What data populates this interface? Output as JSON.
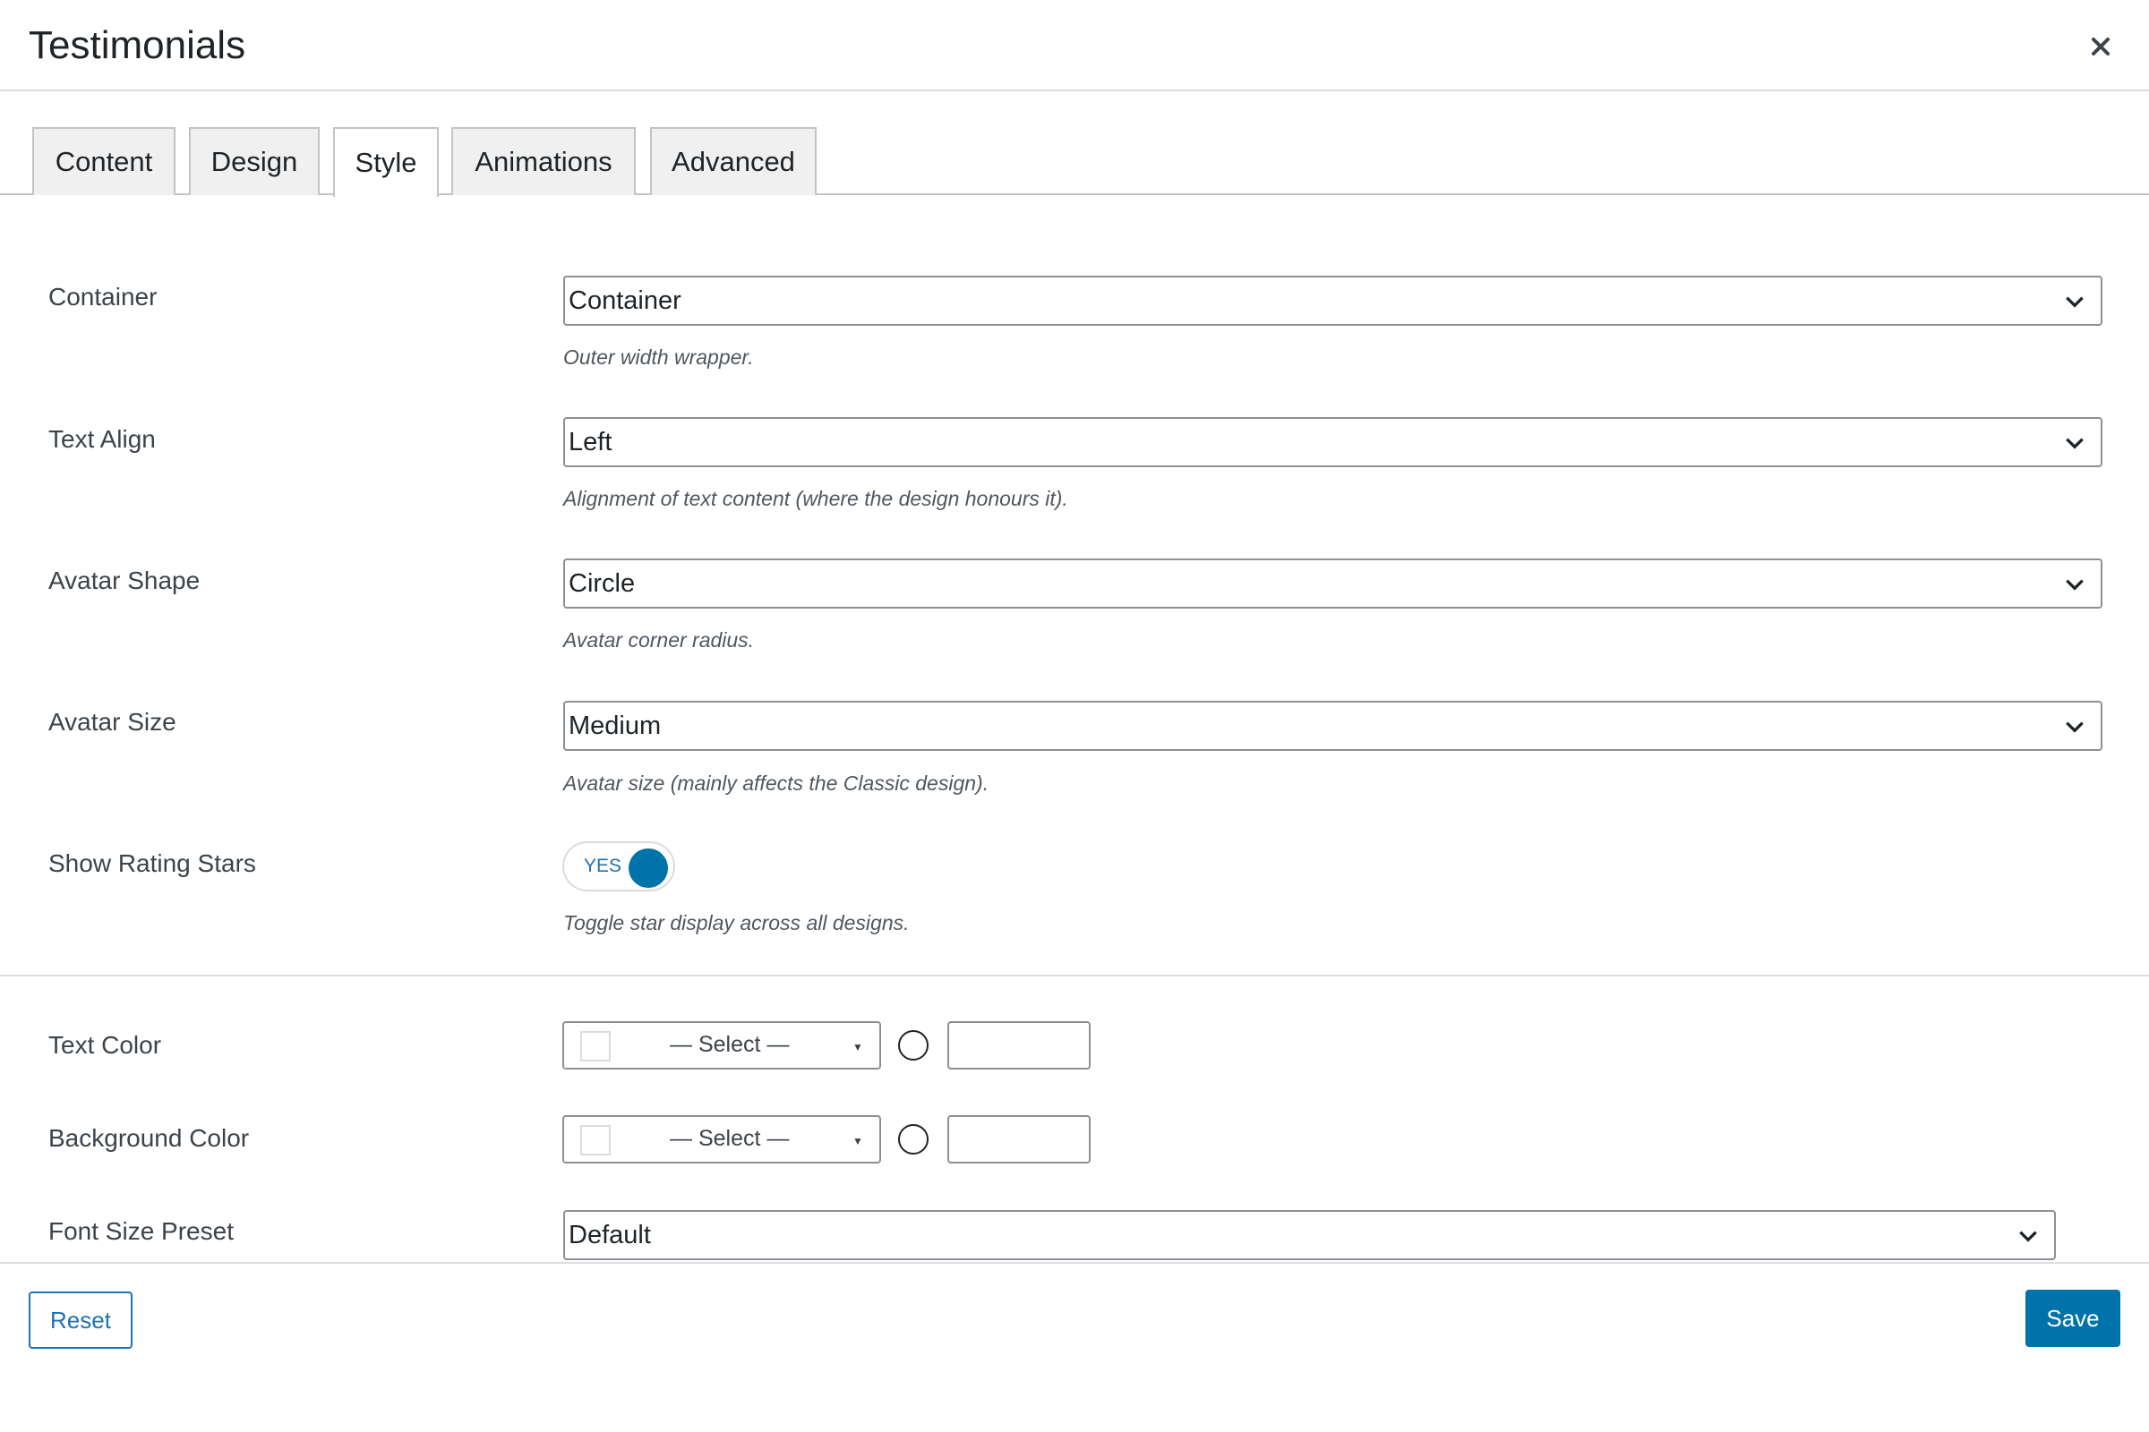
{
  "modal": {
    "title": "Testimonials",
    "close_icon": "close-icon"
  },
  "tabs": [
    {
      "label": "Content",
      "active": false
    },
    {
      "label": "Design",
      "active": false
    },
    {
      "label": "Style",
      "active": true
    },
    {
      "label": "Animations",
      "active": false
    },
    {
      "label": "Advanced",
      "active": false
    }
  ],
  "fields": {
    "container": {
      "label": "Container",
      "value": "Container",
      "description": "Outer width wrapper."
    },
    "text_align": {
      "label": "Text Align",
      "value": "Left",
      "description": "Alignment of text content (where the design honours it)."
    },
    "avatar_shape": {
      "label": "Avatar Shape",
      "value": "Circle",
      "description": "Avatar corner radius."
    },
    "avatar_size": {
      "label": "Avatar Size",
      "value": "Medium",
      "description": "Avatar size (mainly affects the Classic design)."
    },
    "show_rating_stars": {
      "label": "Show Rating Stars",
      "toggle_label": "YES",
      "enabled": true,
      "description": "Toggle star display across all designs."
    },
    "text_color": {
      "label": "Text Color",
      "select_text": "— Select —",
      "hex_value": ""
    },
    "background_color": {
      "label": "Background Color",
      "select_text": "— Select —",
      "hex_value": ""
    },
    "font_size_preset": {
      "label": "Font Size Preset",
      "value": "Default"
    }
  },
  "footer": {
    "reset_label": "Reset",
    "save_label": "Save"
  },
  "colors": {
    "accent": "#0073aa",
    "link": "#2271b1",
    "border": "#8c8f94",
    "tab_bg": "#f0f0f1"
  }
}
